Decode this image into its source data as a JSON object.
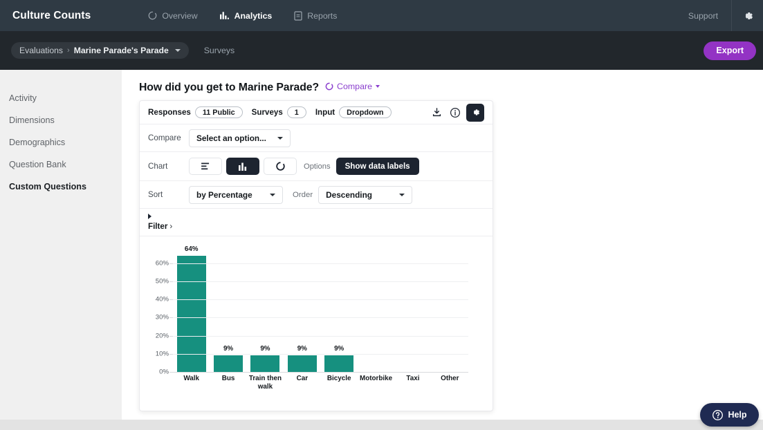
{
  "topnav": {
    "brand": "Culture Counts",
    "items": [
      {
        "label": "Overview",
        "icon": "circle-spinner-icon",
        "active": false
      },
      {
        "label": "Analytics",
        "icon": "bar-chart-icon",
        "active": true
      },
      {
        "label": "Reports",
        "icon": "document-icon",
        "active": false
      }
    ],
    "support_label": "Support",
    "settings_icon": "gear-icon"
  },
  "breadcrumb": {
    "root": "Evaluations",
    "separator": "›",
    "current": "Marine Parade's Parade",
    "surveys_label": "Surveys",
    "export_label": "Export",
    "export_color": "#9333c4"
  },
  "sidebar": {
    "items": [
      {
        "label": "Activity",
        "active": false
      },
      {
        "label": "Dimensions",
        "active": false
      },
      {
        "label": "Demographics",
        "active": false
      },
      {
        "label": "Question Bank",
        "active": false
      },
      {
        "label": "Custom Questions",
        "active": true
      }
    ]
  },
  "page": {
    "title": "How did you get to Marine Parade?",
    "compare_label": "Compare",
    "compare_color": "#8a3ece"
  },
  "card": {
    "meta": {
      "responses_label": "Responses",
      "responses_value": "11 Public",
      "surveys_label": "Surveys",
      "surveys_value": "1",
      "input_label": "Input",
      "input_value": "Dropdown",
      "icons": [
        "download-icon",
        "info-circle-icon",
        "gear-icon"
      ]
    },
    "compare_row": {
      "label": "Compare",
      "select_value": "Select an option..."
    },
    "chart_row": {
      "label": "Chart",
      "types": [
        {
          "name": "horizontal-bar",
          "active": false
        },
        {
          "name": "vertical-bar",
          "active": true
        },
        {
          "name": "donut",
          "active": false
        }
      ],
      "options_label": "Options",
      "data_labels_btn": "Show data labels"
    },
    "sort_row": {
      "label": "Sort",
      "sort_value": "by Percentage",
      "order_label": "Order",
      "order_value": "Descending"
    },
    "filter_row": {
      "label": "Filter",
      "chevron": "›"
    }
  },
  "chart_data": {
    "type": "bar",
    "title": "How did you get to Marine Parade?",
    "xlabel": "",
    "ylabel": "",
    "categories": [
      "Walk",
      "Bus",
      "Train then walk",
      "Car",
      "Bicycle",
      "Motorbike",
      "Taxi",
      "Other"
    ],
    "values": [
      64,
      9,
      9,
      9,
      9,
      0,
      0,
      0
    ],
    "data_labels": [
      "64%",
      "9%",
      "9%",
      "9%",
      "9%",
      "",
      "",
      ""
    ],
    "ylim": [
      0,
      64
    ],
    "yticks": [
      0,
      10,
      20,
      30,
      40,
      50,
      60
    ],
    "ytick_labels": [
      "0%",
      "10%",
      "20%",
      "30%",
      "40%",
      "50%",
      "60%"
    ],
    "grid": true,
    "legend": "none",
    "bar_color": "#16907f",
    "sort": "by Percentage",
    "order": "Descending"
  },
  "help": {
    "label": "Help",
    "icon": "question-circle-icon",
    "color": "#1f2a52"
  }
}
